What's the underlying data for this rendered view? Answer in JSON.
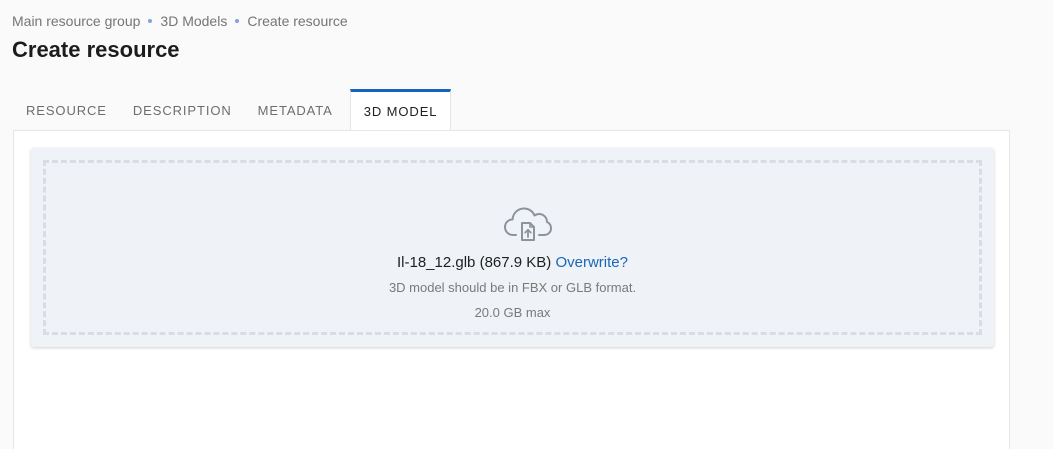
{
  "breadcrumb": {
    "items": [
      "Main resource group",
      "3D Models",
      "Create resource"
    ]
  },
  "page": {
    "title": "Create resource"
  },
  "tabs": [
    {
      "label": "RESOURCE",
      "active": false
    },
    {
      "label": "DESCRIPTION",
      "active": false
    },
    {
      "label": "METADATA",
      "active": false
    },
    {
      "label": "3D MODEL",
      "active": true
    }
  ],
  "upload": {
    "icon": "cloud-file-upload-icon",
    "file_name": "Il-18_12.glb",
    "file_size": "(867.9 KB)",
    "overwrite_label": "Overwrite?",
    "format_hint": "3D model should be in FBX or GLB format.",
    "max_size": "20.0 GB max"
  },
  "colors": {
    "accent": "#1565c0",
    "link": "#1a66b8",
    "dropzone_bg": "#eff2f6",
    "breadcrumb_separator": "#7ea7d8"
  }
}
